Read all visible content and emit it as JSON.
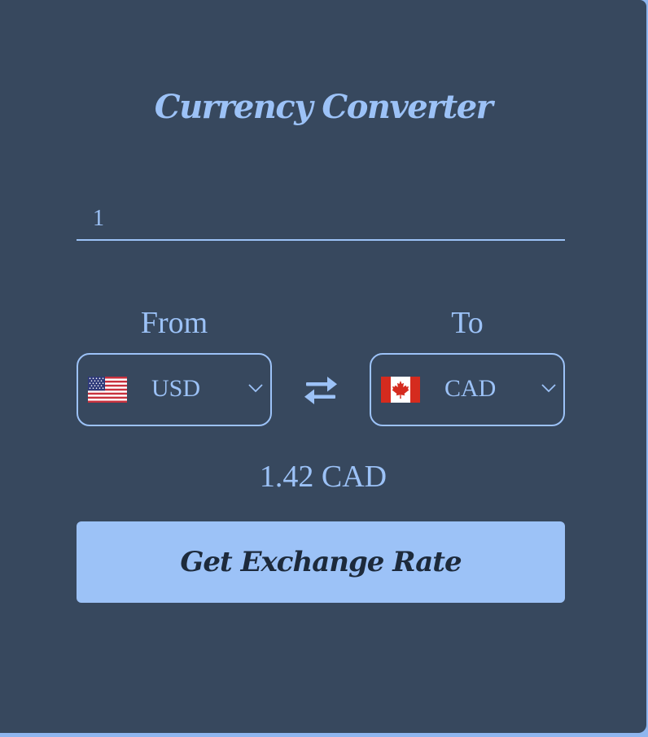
{
  "app": {
    "title": "Currency Converter"
  },
  "amount": {
    "value": "1"
  },
  "from": {
    "label": "From",
    "currency": "USD",
    "flag_icon": "us-flag-icon"
  },
  "to": {
    "label": "To",
    "currency": "CAD",
    "flag_icon": "canada-flag-icon"
  },
  "swap": {
    "icon": "swap-arrows-icon"
  },
  "result": {
    "text": "1.42 CAD"
  },
  "button": {
    "label": "Get Exchange Rate"
  },
  "colors": {
    "background": "#37485e",
    "accent": "#9cc2f7",
    "button_text": "#1d2a3b"
  }
}
